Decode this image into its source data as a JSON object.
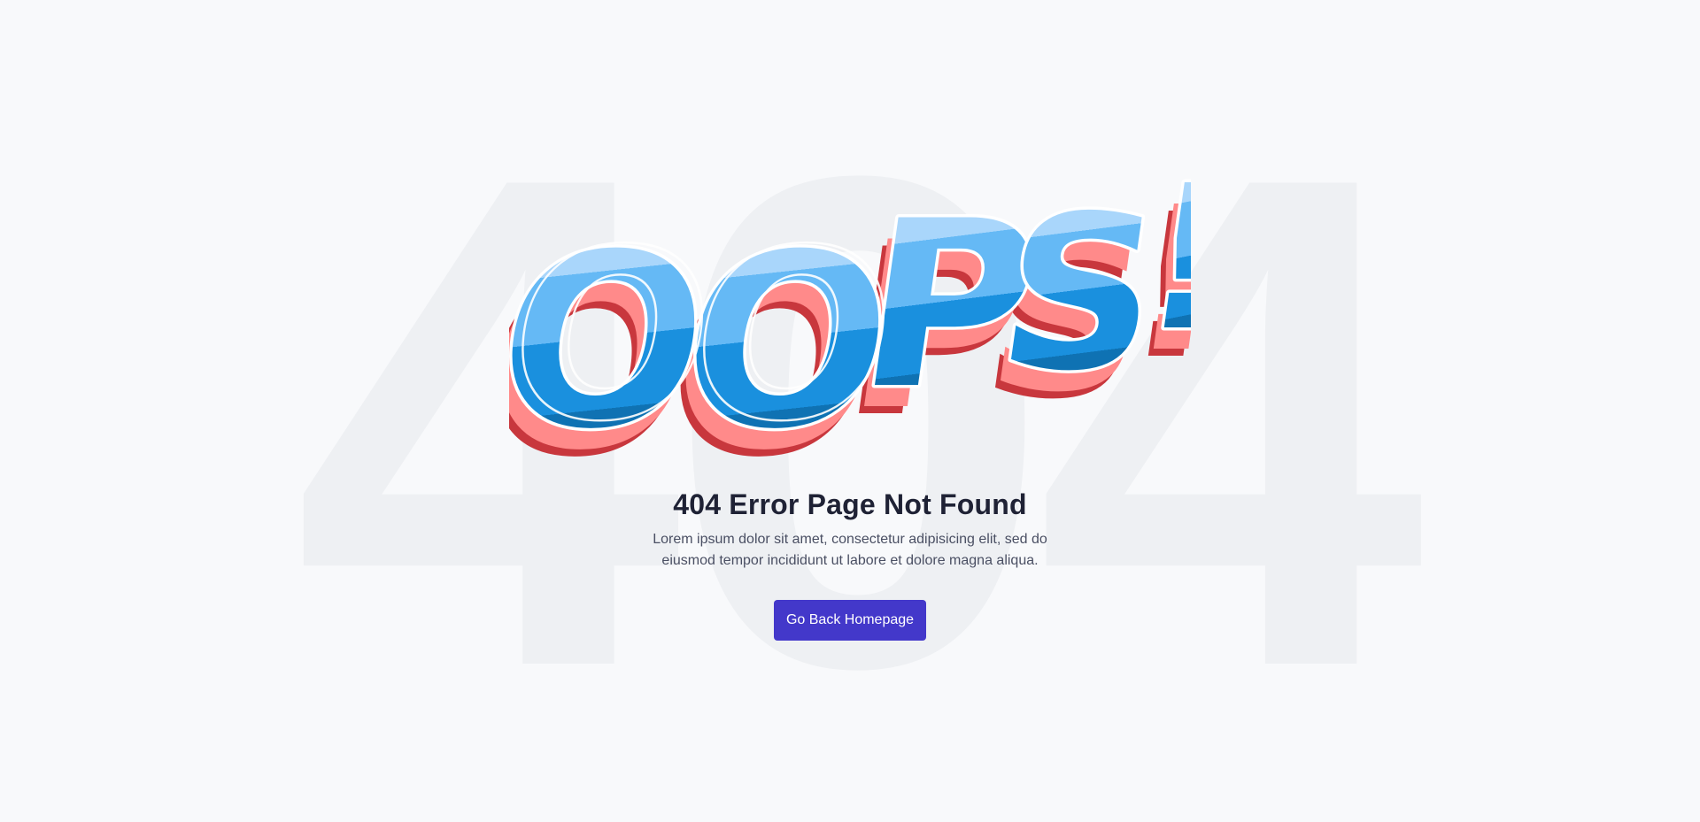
{
  "background": {
    "big_text": "404",
    "color": "#eef0f3"
  },
  "illustration": {
    "text": "OOPS!",
    "colors": {
      "light_blue": "#a9d6fb",
      "mid_blue": "#65b9f5",
      "blue": "#1a90de",
      "dark_blue": "#0f72b3",
      "pink": "#ff8a8a",
      "dark_red": "#c8373d",
      "outline": "#ffffff"
    }
  },
  "main": {
    "title": "404 Error Page Not Found",
    "description": "Lorem ipsum dolor sit amet, consectetur adipisicing elit, sed do eiusmod tempor incididunt ut labore et dolore magna aliqua.",
    "button_label": "Go Back Homepage",
    "button_color": "#4338ca"
  }
}
